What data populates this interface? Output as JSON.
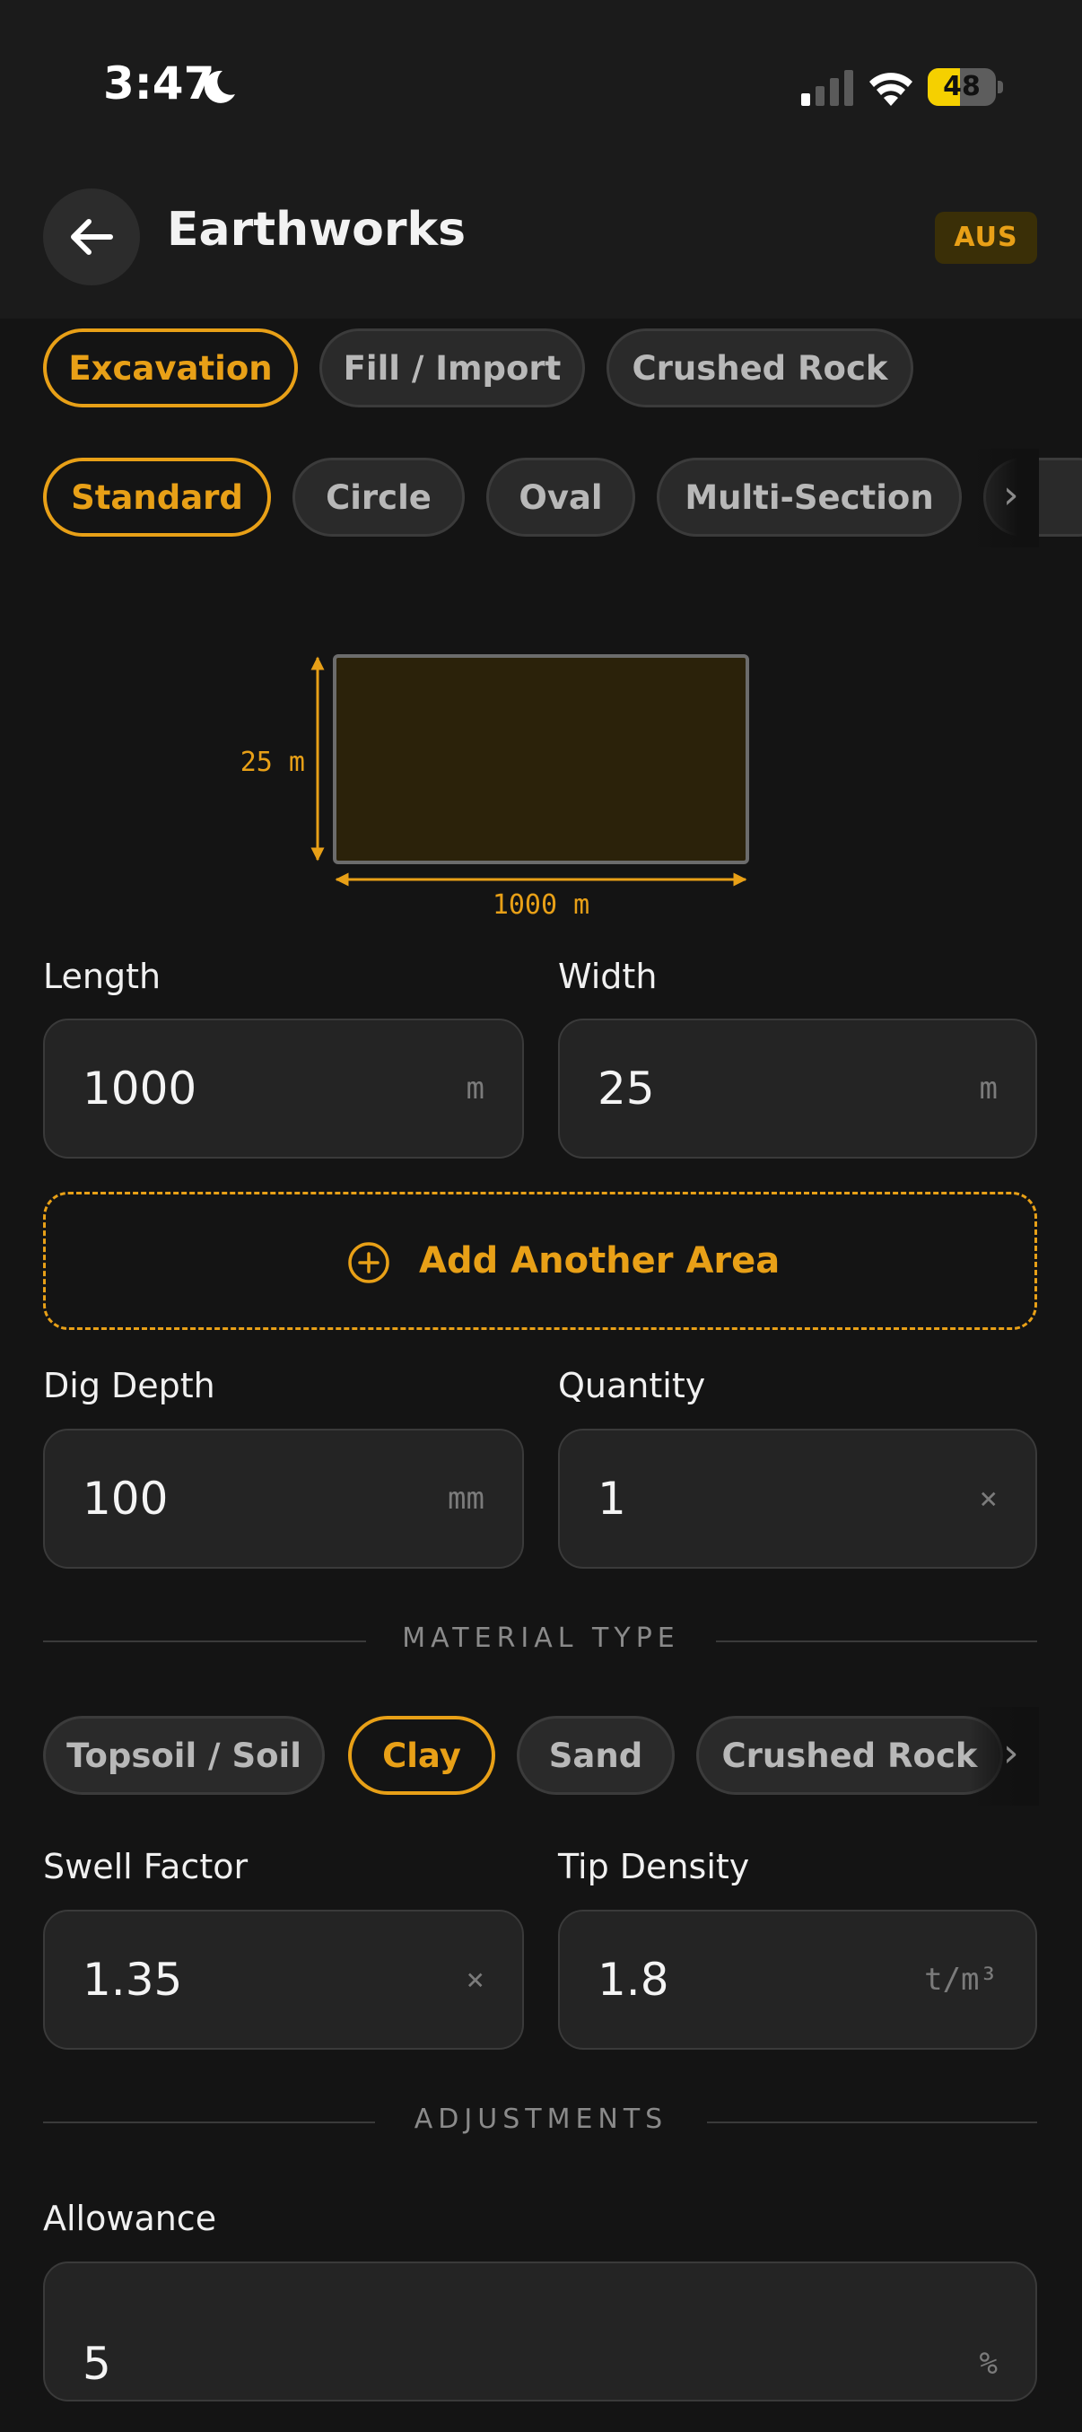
{
  "status_bar": {
    "time": "3:47",
    "battery_percent": 48,
    "battery_label": "48"
  },
  "header": {
    "title": "Earthworks",
    "region": "AUS"
  },
  "job_tabs": [
    {
      "label": "Excavation",
      "active": true
    },
    {
      "label": "Fill / Import",
      "active": false
    },
    {
      "label": "Crushed Rock",
      "active": false
    }
  ],
  "shape_tabs": [
    {
      "label": "Standard",
      "active": true
    },
    {
      "label": "Circle",
      "active": false
    },
    {
      "label": "Oval",
      "active": false
    },
    {
      "label": "Multi-Section",
      "active": false
    }
  ],
  "diagram": {
    "width_label": "25 m",
    "length_label": "1000 m"
  },
  "fields": {
    "length": {
      "label": "Length",
      "value": "1000",
      "unit": "m"
    },
    "width": {
      "label": "Width",
      "value": "25",
      "unit": "m"
    },
    "dig_depth": {
      "label": "Dig Depth",
      "value": "100",
      "unit": "mm"
    },
    "quantity": {
      "label": "Quantity",
      "value": "1",
      "unit": "×"
    },
    "swell_factor": {
      "label": "Swell Factor",
      "value": "1.35",
      "unit": "×"
    },
    "tip_density": {
      "label": "Tip Density",
      "value": "1.8",
      "unit": "t/m³"
    },
    "allowance": {
      "label": "Allowance",
      "value": "5",
      "unit": "%"
    }
  },
  "add_area_label": "Add Another Area",
  "material_section_title": "MATERIAL TYPE",
  "material_tabs": [
    {
      "label": "Topsoil / Soil",
      "active": false
    },
    {
      "label": "Clay",
      "active": true
    },
    {
      "label": "Sand",
      "active": false
    },
    {
      "label": "Crushed Rock",
      "active": false
    }
  ],
  "adjustments_section_title": "ADJUSTMENTS",
  "colors": {
    "accent": "#e8a017",
    "background": "#141414",
    "card": "#242424"
  }
}
